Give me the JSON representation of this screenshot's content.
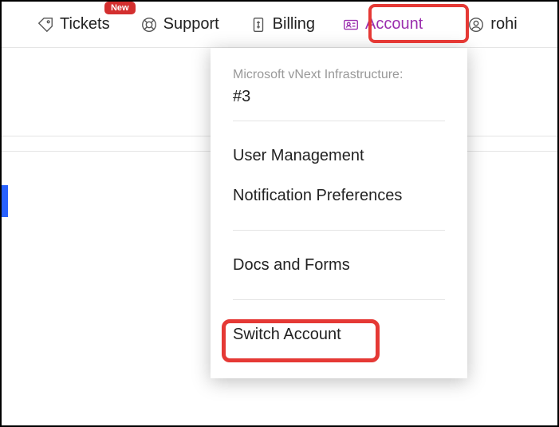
{
  "nav": {
    "tickets": {
      "label": "Tickets",
      "badge": "New"
    },
    "support": {
      "label": "Support"
    },
    "billing": {
      "label": "Billing"
    },
    "account": {
      "label": "Account"
    },
    "user": {
      "label": "rohi"
    }
  },
  "dropdown": {
    "header_label": "Microsoft vNext Infrastructure:",
    "header_value": "#3",
    "items": {
      "user_management": "User Management",
      "notification_preferences": "Notification Preferences",
      "docs_and_forms": "Docs and Forms",
      "switch_account": "Switch Account"
    }
  }
}
